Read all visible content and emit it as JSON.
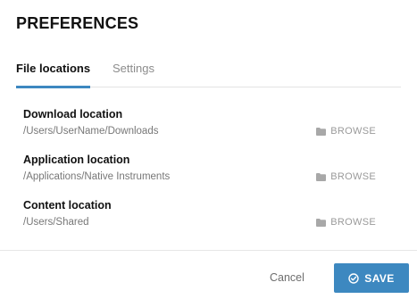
{
  "dialog": {
    "title": "PREFERENCES"
  },
  "tabs": [
    {
      "label": "File locations",
      "active": true
    },
    {
      "label": "Settings",
      "active": false
    }
  ],
  "locations": [
    {
      "label": "Download location",
      "path": "/Users/UserName/Downloads",
      "browse_label": "BROWSE"
    },
    {
      "label": "Application location",
      "path": "/Applications/Native Instruments",
      "browse_label": "BROWSE"
    },
    {
      "label": "Content location",
      "path": "/Users/Shared",
      "browse_label": "BROWSE"
    }
  ],
  "footer": {
    "cancel_label": "Cancel",
    "save_label": "SAVE"
  },
  "icons": {
    "browse": "folder-icon",
    "save": "check-circle-icon"
  },
  "colors": {
    "accent": "#3d88c0",
    "muted": "#9a9a9a"
  }
}
